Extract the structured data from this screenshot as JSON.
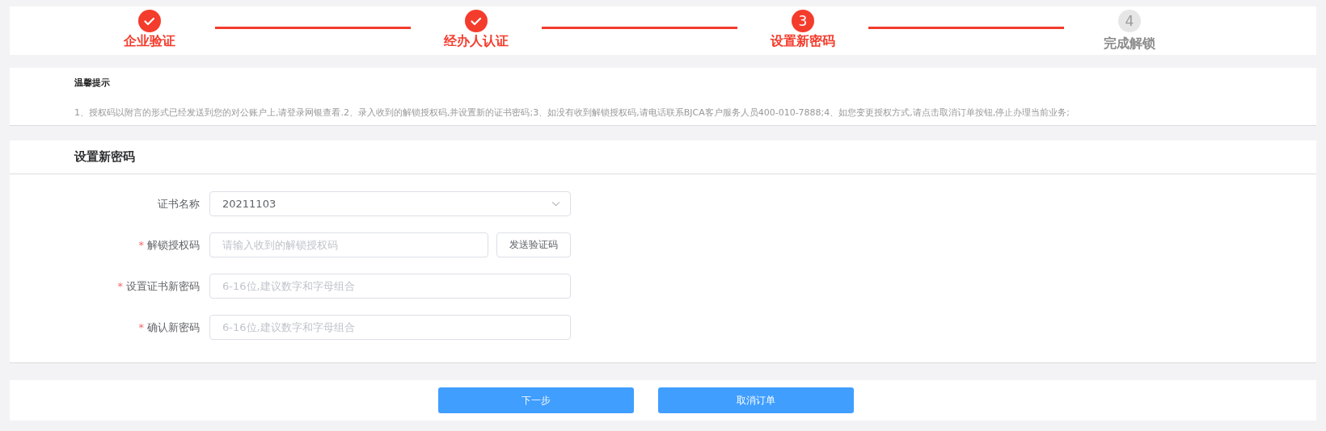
{
  "steps": [
    {
      "label": "企业验证",
      "done": true,
      "active": true
    },
    {
      "label": "经办人认证",
      "done": true,
      "active": true
    },
    {
      "number": "3",
      "label": "设置新密码",
      "done": false,
      "active": true
    },
    {
      "number": "4",
      "label": "完成解锁",
      "done": false,
      "active": false
    }
  ],
  "notice": {
    "title": "温馨提示",
    "text": "1、授权码以附言的形式已经发送到您的对公账户上,请登录网银查看.2、录入收到的解锁授权码,并设置新的证书密码;3、如没有收到解锁授权码,请电话联系BJCA客户服务人员400-010-7888;4、如您变更授权方式,请点击取消订单按钮,停止办理当前业务;"
  },
  "form": {
    "title": "设置新密码",
    "fields": [
      {
        "kind": "select",
        "label": "证书名称",
        "value": "20211103"
      },
      {
        "kind": "input",
        "label": "解锁授权码",
        "required_mark": "*",
        "placeholder": "请输入收到的解锁授权码",
        "action": "发送验证码"
      },
      {
        "kind": "input",
        "label": "设置证书新密码",
        "required_mark": "*",
        "placeholder": "6-16位,建议数字和字母组合"
      },
      {
        "kind": "input",
        "label": "确认新密码",
        "required_mark": "*",
        "placeholder": "6-16位,建议数字和字母组合"
      }
    ]
  },
  "buttons": [
    "下一步",
    "取消订单"
  ]
}
